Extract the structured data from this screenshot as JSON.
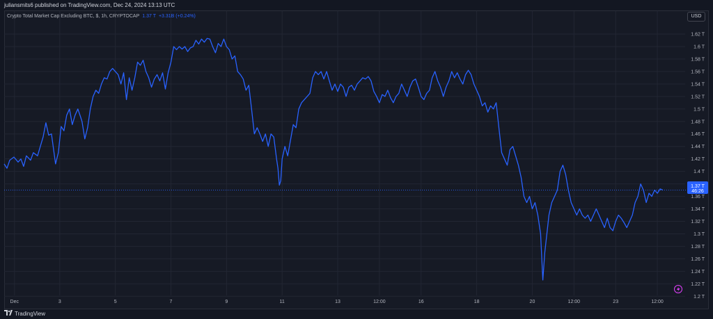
{
  "header": {
    "publish_text": "juliansmits6 published on TradingView.com, Dec 24, 2024 13:13 UTC"
  },
  "legend": {
    "symbol": "Crypto Total Market Cap Excluding BTC, $, 1h, CRYPTOCAP",
    "value": "1.37 T",
    "change": "+3.31B (+0.24%)"
  },
  "currency_button": "USD",
  "price_tag": {
    "value": "1.37 T",
    "countdown": "46:26"
  },
  "footer": {
    "brand": "TradingView"
  },
  "colors": {
    "line": "#2962ff",
    "background": "#161a25",
    "grid": "#222633",
    "axis_text": "#b2b5be",
    "alert_icon": "#e040fb"
  },
  "icons": [
    "lightning-icon",
    "tradingview-logo-icon"
  ],
  "chart_data": {
    "type": "line",
    "title": "Crypto Total Market Cap Excluding BTC, $, 1h, CRYPTOCAP",
    "xlabel": "",
    "ylabel": "",
    "ylim": [
      1.19,
      1.645
    ],
    "y_unit": "T",
    "grid": true,
    "legend": "top-left",
    "y_ticks": [
      "1.62 T",
      "1.6 T",
      "1.58 T",
      "1.56 T",
      "1.54 T",
      "1.52 T",
      "1.5 T",
      "1.48 T",
      "1.46 T",
      "1.44 T",
      "1.42 T",
      "1.4 T",
      "1.38 T",
      "1.36 T",
      "1.34 T",
      "1.32 T",
      "1.3 T",
      "1.28 T",
      "1.26 T",
      "1.24 T",
      "1.22 T",
      "1.2 T"
    ],
    "y_tick_values": [
      1.62,
      1.6,
      1.58,
      1.56,
      1.54,
      1.52,
      1.5,
      1.48,
      1.46,
      1.44,
      1.42,
      1.4,
      1.38,
      1.36,
      1.34,
      1.32,
      1.3,
      1.28,
      1.26,
      1.24,
      1.22,
      1.2
    ],
    "x_ticks": [
      {
        "label": "Dec",
        "pos": 0.37
      },
      {
        "label": "3",
        "pos": 2.0
      },
      {
        "label": "5",
        "pos": 4.0
      },
      {
        "label": "7",
        "pos": 6.0
      },
      {
        "label": "9",
        "pos": 8.0
      },
      {
        "label": "11",
        "pos": 10.0
      },
      {
        "label": "13",
        "pos": 12.0
      },
      {
        "label": "12:00",
        "pos": 13.5
      },
      {
        "label": "16",
        "pos": 15.0
      },
      {
        "label": "18",
        "pos": 17.0
      },
      {
        "label": "20",
        "pos": 19.0
      },
      {
        "label": "12:00",
        "pos": 20.5
      },
      {
        "label": "23",
        "pos": 22.0
      },
      {
        "label": "12:00",
        "pos": 23.5
      }
    ],
    "x_range": [
      0.0,
      24.5
    ],
    "series": [
      {
        "values": [
          [
            0.0,
            1.412
          ],
          [
            0.1,
            1.405
          ],
          [
            0.2,
            1.418
          ],
          [
            0.35,
            1.423
          ],
          [
            0.5,
            1.415
          ],
          [
            0.6,
            1.42
          ],
          [
            0.7,
            1.408
          ],
          [
            0.8,
            1.425
          ],
          [
            0.95,
            1.418
          ],
          [
            1.05,
            1.43
          ],
          [
            1.2,
            1.425
          ],
          [
            1.3,
            1.44
          ],
          [
            1.4,
            1.455
          ],
          [
            1.5,
            1.478
          ],
          [
            1.6,
            1.458
          ],
          [
            1.7,
            1.46
          ],
          [
            1.85,
            1.412
          ],
          [
            1.95,
            1.43
          ],
          [
            2.05,
            1.472
          ],
          [
            2.15,
            1.465
          ],
          [
            2.25,
            1.49
          ],
          [
            2.35,
            1.5
          ],
          [
            2.45,
            1.475
          ],
          [
            2.55,
            1.49
          ],
          [
            2.65,
            1.5
          ],
          [
            2.75,
            1.487
          ],
          [
            2.8,
            1.48
          ],
          [
            2.9,
            1.452
          ],
          [
            3.0,
            1.47
          ],
          [
            3.1,
            1.5
          ],
          [
            3.2,
            1.52
          ],
          [
            3.3,
            1.53
          ],
          [
            3.4,
            1.525
          ],
          [
            3.5,
            1.54
          ],
          [
            3.6,
            1.55
          ],
          [
            3.7,
            1.548
          ],
          [
            3.8,
            1.56
          ],
          [
            3.9,
            1.565
          ],
          [
            4.0,
            1.56
          ],
          [
            4.1,
            1.555
          ],
          [
            4.2,
            1.54
          ],
          [
            4.3,
            1.558
          ],
          [
            4.4,
            1.515
          ],
          [
            4.5,
            1.55
          ],
          [
            4.6,
            1.53
          ],
          [
            4.7,
            1.55
          ],
          [
            4.8,
            1.575
          ],
          [
            4.9,
            1.57
          ],
          [
            5.0,
            1.578
          ],
          [
            5.1,
            1.56
          ],
          [
            5.2,
            1.55
          ],
          [
            5.3,
            1.535
          ],
          [
            5.4,
            1.548
          ],
          [
            5.5,
            1.555
          ],
          [
            5.6,
            1.545
          ],
          [
            5.7,
            1.558
          ],
          [
            5.8,
            1.532
          ],
          [
            5.9,
            1.558
          ],
          [
            6.0,
            1.575
          ],
          [
            6.1,
            1.6
          ],
          [
            6.2,
            1.595
          ],
          [
            6.3,
            1.6
          ],
          [
            6.4,
            1.596
          ],
          [
            6.5,
            1.6
          ],
          [
            6.6,
            1.592
          ],
          [
            6.7,
            1.598
          ],
          [
            6.8,
            1.6
          ],
          [
            6.9,
            1.61
          ],
          [
            7.0,
            1.604
          ],
          [
            7.1,
            1.612
          ],
          [
            7.2,
            1.607
          ],
          [
            7.3,
            1.613
          ],
          [
            7.4,
            1.612
          ],
          [
            7.5,
            1.6
          ],
          [
            7.6,
            1.59
          ],
          [
            7.7,
            1.605
          ],
          [
            7.8,
            1.6
          ],
          [
            7.9,
            1.612
          ],
          [
            8.0,
            1.6
          ],
          [
            8.1,
            1.595
          ],
          [
            8.2,
            1.58
          ],
          [
            8.3,
            1.585
          ],
          [
            8.4,
            1.56
          ],
          [
            8.5,
            1.555
          ],
          [
            8.6,
            1.548
          ],
          [
            8.7,
            1.53
          ],
          [
            8.8,
            1.538
          ],
          [
            8.9,
            1.5
          ],
          [
            9.0,
            1.46
          ],
          [
            9.1,
            1.47
          ],
          [
            9.2,
            1.46
          ],
          [
            9.3,
            1.448
          ],
          [
            9.4,
            1.46
          ],
          [
            9.5,
            1.44
          ],
          [
            9.6,
            1.46
          ],
          [
            9.7,
            1.455
          ],
          [
            9.8,
            1.42
          ],
          [
            9.85,
            1.405
          ],
          [
            9.9,
            1.378
          ],
          [
            9.95,
            1.385
          ],
          [
            10.0,
            1.42
          ],
          [
            10.1,
            1.44
          ],
          [
            10.2,
            1.425
          ],
          [
            10.3,
            1.45
          ],
          [
            10.4,
            1.475
          ],
          [
            10.5,
            1.47
          ],
          [
            10.6,
            1.5
          ],
          [
            10.7,
            1.51
          ],
          [
            10.8,
            1.515
          ],
          [
            10.9,
            1.52
          ],
          [
            11.0,
            1.525
          ],
          [
            11.1,
            1.55
          ],
          [
            11.2,
            1.56
          ],
          [
            11.3,
            1.555
          ],
          [
            11.4,
            1.56
          ],
          [
            11.5,
            1.548
          ],
          [
            11.6,
            1.56
          ],
          [
            11.7,
            1.545
          ],
          [
            11.8,
            1.53
          ],
          [
            11.9,
            1.54
          ],
          [
            12.0,
            1.528
          ],
          [
            12.1,
            1.54
          ],
          [
            12.2,
            1.535
          ],
          [
            12.3,
            1.52
          ],
          [
            12.4,
            1.535
          ],
          [
            12.5,
            1.538
          ],
          [
            12.6,
            1.53
          ],
          [
            12.7,
            1.54
          ],
          [
            12.8,
            1.545
          ],
          [
            12.9,
            1.55
          ],
          [
            13.0,
            1.548
          ],
          [
            13.1,
            1.552
          ],
          [
            13.2,
            1.545
          ],
          [
            13.3,
            1.528
          ],
          [
            13.4,
            1.52
          ],
          [
            13.5,
            1.51
          ],
          [
            13.6,
            1.523
          ],
          [
            13.7,
            1.52
          ],
          [
            13.8,
            1.53
          ],
          [
            13.9,
            1.518
          ],
          [
            14.0,
            1.51
          ],
          [
            14.1,
            1.52
          ],
          [
            14.2,
            1.525
          ],
          [
            14.3,
            1.54
          ],
          [
            14.4,
            1.53
          ],
          [
            14.5,
            1.52
          ],
          [
            14.6,
            1.535
          ],
          [
            14.7,
            1.545
          ],
          [
            14.8,
            1.548
          ],
          [
            14.9,
            1.535
          ],
          [
            15.0,
            1.52
          ],
          [
            15.1,
            1.515
          ],
          [
            15.2,
            1.525
          ],
          [
            15.3,
            1.53
          ],
          [
            15.4,
            1.55
          ],
          [
            15.5,
            1.56
          ],
          [
            15.6,
            1.545
          ],
          [
            15.7,
            1.535
          ],
          [
            15.8,
            1.52
          ],
          [
            15.9,
            1.535
          ],
          [
            16.0,
            1.545
          ],
          [
            16.1,
            1.56
          ],
          [
            16.2,
            1.55
          ],
          [
            16.3,
            1.558
          ],
          [
            16.4,
            1.548
          ],
          [
            16.5,
            1.54
          ],
          [
            16.6,
            1.555
          ],
          [
            16.7,
            1.562
          ],
          [
            16.8,
            1.555
          ],
          [
            16.9,
            1.54
          ],
          [
            17.0,
            1.53
          ],
          [
            17.1,
            1.52
          ],
          [
            17.2,
            1.505
          ],
          [
            17.3,
            1.51
          ],
          [
            17.4,
            1.495
          ],
          [
            17.5,
            1.505
          ],
          [
            17.6,
            1.5
          ],
          [
            17.7,
            1.51
          ],
          [
            17.8,
            1.47
          ],
          [
            17.9,
            1.43
          ],
          [
            18.0,
            1.42
          ],
          [
            18.1,
            1.41
          ],
          [
            18.2,
            1.435
          ],
          [
            18.3,
            1.44
          ],
          [
            18.4,
            1.425
          ],
          [
            18.5,
            1.41
          ],
          [
            18.6,
            1.39
          ],
          [
            18.7,
            1.36
          ],
          [
            18.8,
            1.35
          ],
          [
            18.9,
            1.36
          ],
          [
            19.0,
            1.34
          ],
          [
            19.1,
            1.35
          ],
          [
            19.2,
            1.33
          ],
          [
            19.3,
            1.3
          ],
          [
            19.38,
            1.226
          ],
          [
            19.45,
            1.27
          ],
          [
            19.55,
            1.31
          ],
          [
            19.6,
            1.33
          ],
          [
            19.7,
            1.35
          ],
          [
            19.8,
            1.36
          ],
          [
            19.9,
            1.37
          ],
          [
            20.0,
            1.4
          ],
          [
            20.1,
            1.41
          ],
          [
            20.2,
            1.395
          ],
          [
            20.3,
            1.37
          ],
          [
            20.4,
            1.35
          ],
          [
            20.5,
            1.34
          ],
          [
            20.6,
            1.33
          ],
          [
            20.7,
            1.34
          ],
          [
            20.8,
            1.33
          ],
          [
            20.9,
            1.325
          ],
          [
            21.0,
            1.33
          ],
          [
            21.1,
            1.32
          ],
          [
            21.2,
            1.33
          ],
          [
            21.3,
            1.34
          ],
          [
            21.4,
            1.33
          ],
          [
            21.5,
            1.32
          ],
          [
            21.6,
            1.31
          ],
          [
            21.7,
            1.325
          ],
          [
            21.8,
            1.31
          ],
          [
            21.9,
            1.305
          ],
          [
            22.0,
            1.32
          ],
          [
            22.1,
            1.33
          ],
          [
            22.2,
            1.325
          ],
          [
            22.3,
            1.318
          ],
          [
            22.4,
            1.31
          ],
          [
            22.5,
            1.32
          ],
          [
            22.6,
            1.33
          ],
          [
            22.7,
            1.35
          ],
          [
            22.8,
            1.36
          ],
          [
            22.9,
            1.38
          ],
          [
            23.0,
            1.37
          ],
          [
            23.1,
            1.35
          ],
          [
            23.2,
            1.365
          ],
          [
            23.3,
            1.36
          ],
          [
            23.4,
            1.37
          ],
          [
            23.5,
            1.365
          ],
          [
            23.6,
            1.372
          ],
          [
            23.7,
            1.37
          ]
        ]
      }
    ],
    "last_value": 1.37
  }
}
